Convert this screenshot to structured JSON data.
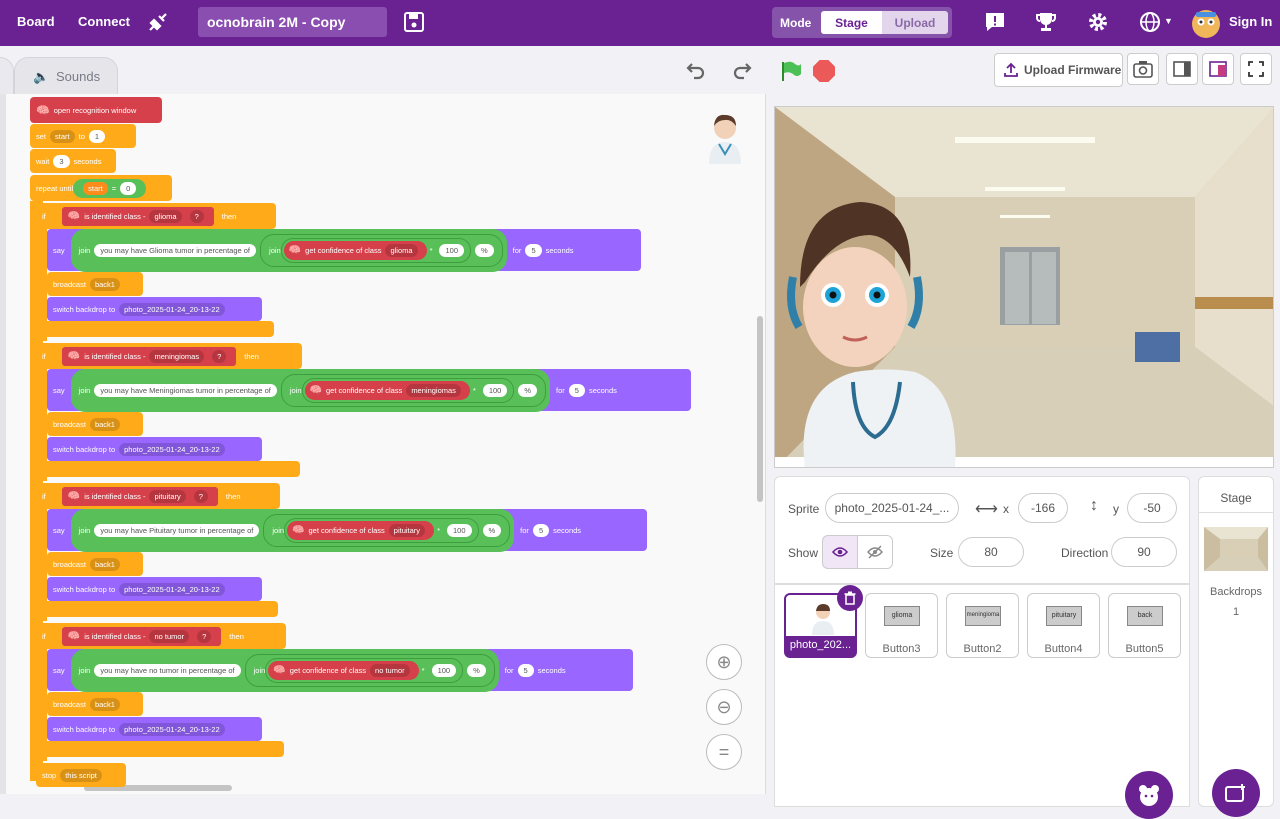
{
  "nav": {
    "board": "Board",
    "connect": "Connect",
    "project": "ocnobrain 2M - Copy",
    "mode_label": "Mode",
    "mode_stage": "Stage",
    "mode_upload": "Upload",
    "signin": "Sign In"
  },
  "tabs": {
    "sounds": "Sounds"
  },
  "toolbar": {
    "upload_firmware": "Upload Firmware"
  },
  "blocks": {
    "open": "open recognition window",
    "set": "set",
    "start": "start",
    "to": "to",
    "one": "1",
    "wait": "wait",
    "three": "3",
    "seconds": "seconds",
    "repeat": "repeat until",
    "eq": "=",
    "zero": "0",
    "if": "if",
    "then": "then",
    "is_id": "is identified class -",
    "q": "?",
    "say": "say",
    "join": "join",
    "conf": "get confidence of class",
    "times": "*",
    "hundred": "100",
    "pct": "%",
    "for": "for",
    "five": "5",
    "broadcast": "broadcast",
    "back1": "back1",
    "switch": "switch backdrop to",
    "backdrop": "photo_2025-01-24_20-13-22",
    "stop": "stop",
    "this_script": "this script",
    "rows": [
      {
        "cls": "glioma",
        "msg": "you may have Glioma tumor in percentage of"
      },
      {
        "cls": "meningiomas",
        "msg": "you may have Meningiomas tumor in percentage of"
      },
      {
        "cls": "pituitary",
        "msg": "you may have Pituitary tumor in percentage of"
      },
      {
        "cls": "no tumor",
        "msg": "you may have no tumor in percentage of"
      }
    ]
  },
  "sprite": {
    "label": "Sprite",
    "name": "photo_2025-01-24_...",
    "x_label": "x",
    "x": "-166",
    "y_label": "y",
    "y": "-50",
    "show": "Show",
    "size_label": "Size",
    "size": "80",
    "dir_label": "Direction",
    "dir": "90"
  },
  "sprites": [
    {
      "name": "photo_202...",
      "img": ""
    },
    {
      "name": "Button3",
      "img": "glioma"
    },
    {
      "name": "Button2",
      "img": "meningioma"
    },
    {
      "name": "Button4",
      "img": "pituitary"
    },
    {
      "name": "Button5",
      "img": "back"
    }
  ],
  "stagecol": {
    "title": "Stage",
    "backdrops": "Backdrops",
    "count": "1"
  },
  "colors": {
    "topbar": "#6a2293",
    "events": "#ffab19",
    "ml": "#d6404a",
    "looks": "#9966ff",
    "operators": "#59c059"
  },
  "icons": [
    "extension-icon",
    "save-icon",
    "feedback-icon",
    "trophy-icon",
    "gear-icon",
    "globe-icon",
    "undo-icon",
    "redo-icon",
    "green-flag-icon",
    "stop-icon",
    "camera-icon",
    "zoom-in-icon",
    "zoom-out-icon",
    "zoom-reset-icon",
    "eye-icon",
    "eye-off-icon",
    "trash-icon"
  ]
}
